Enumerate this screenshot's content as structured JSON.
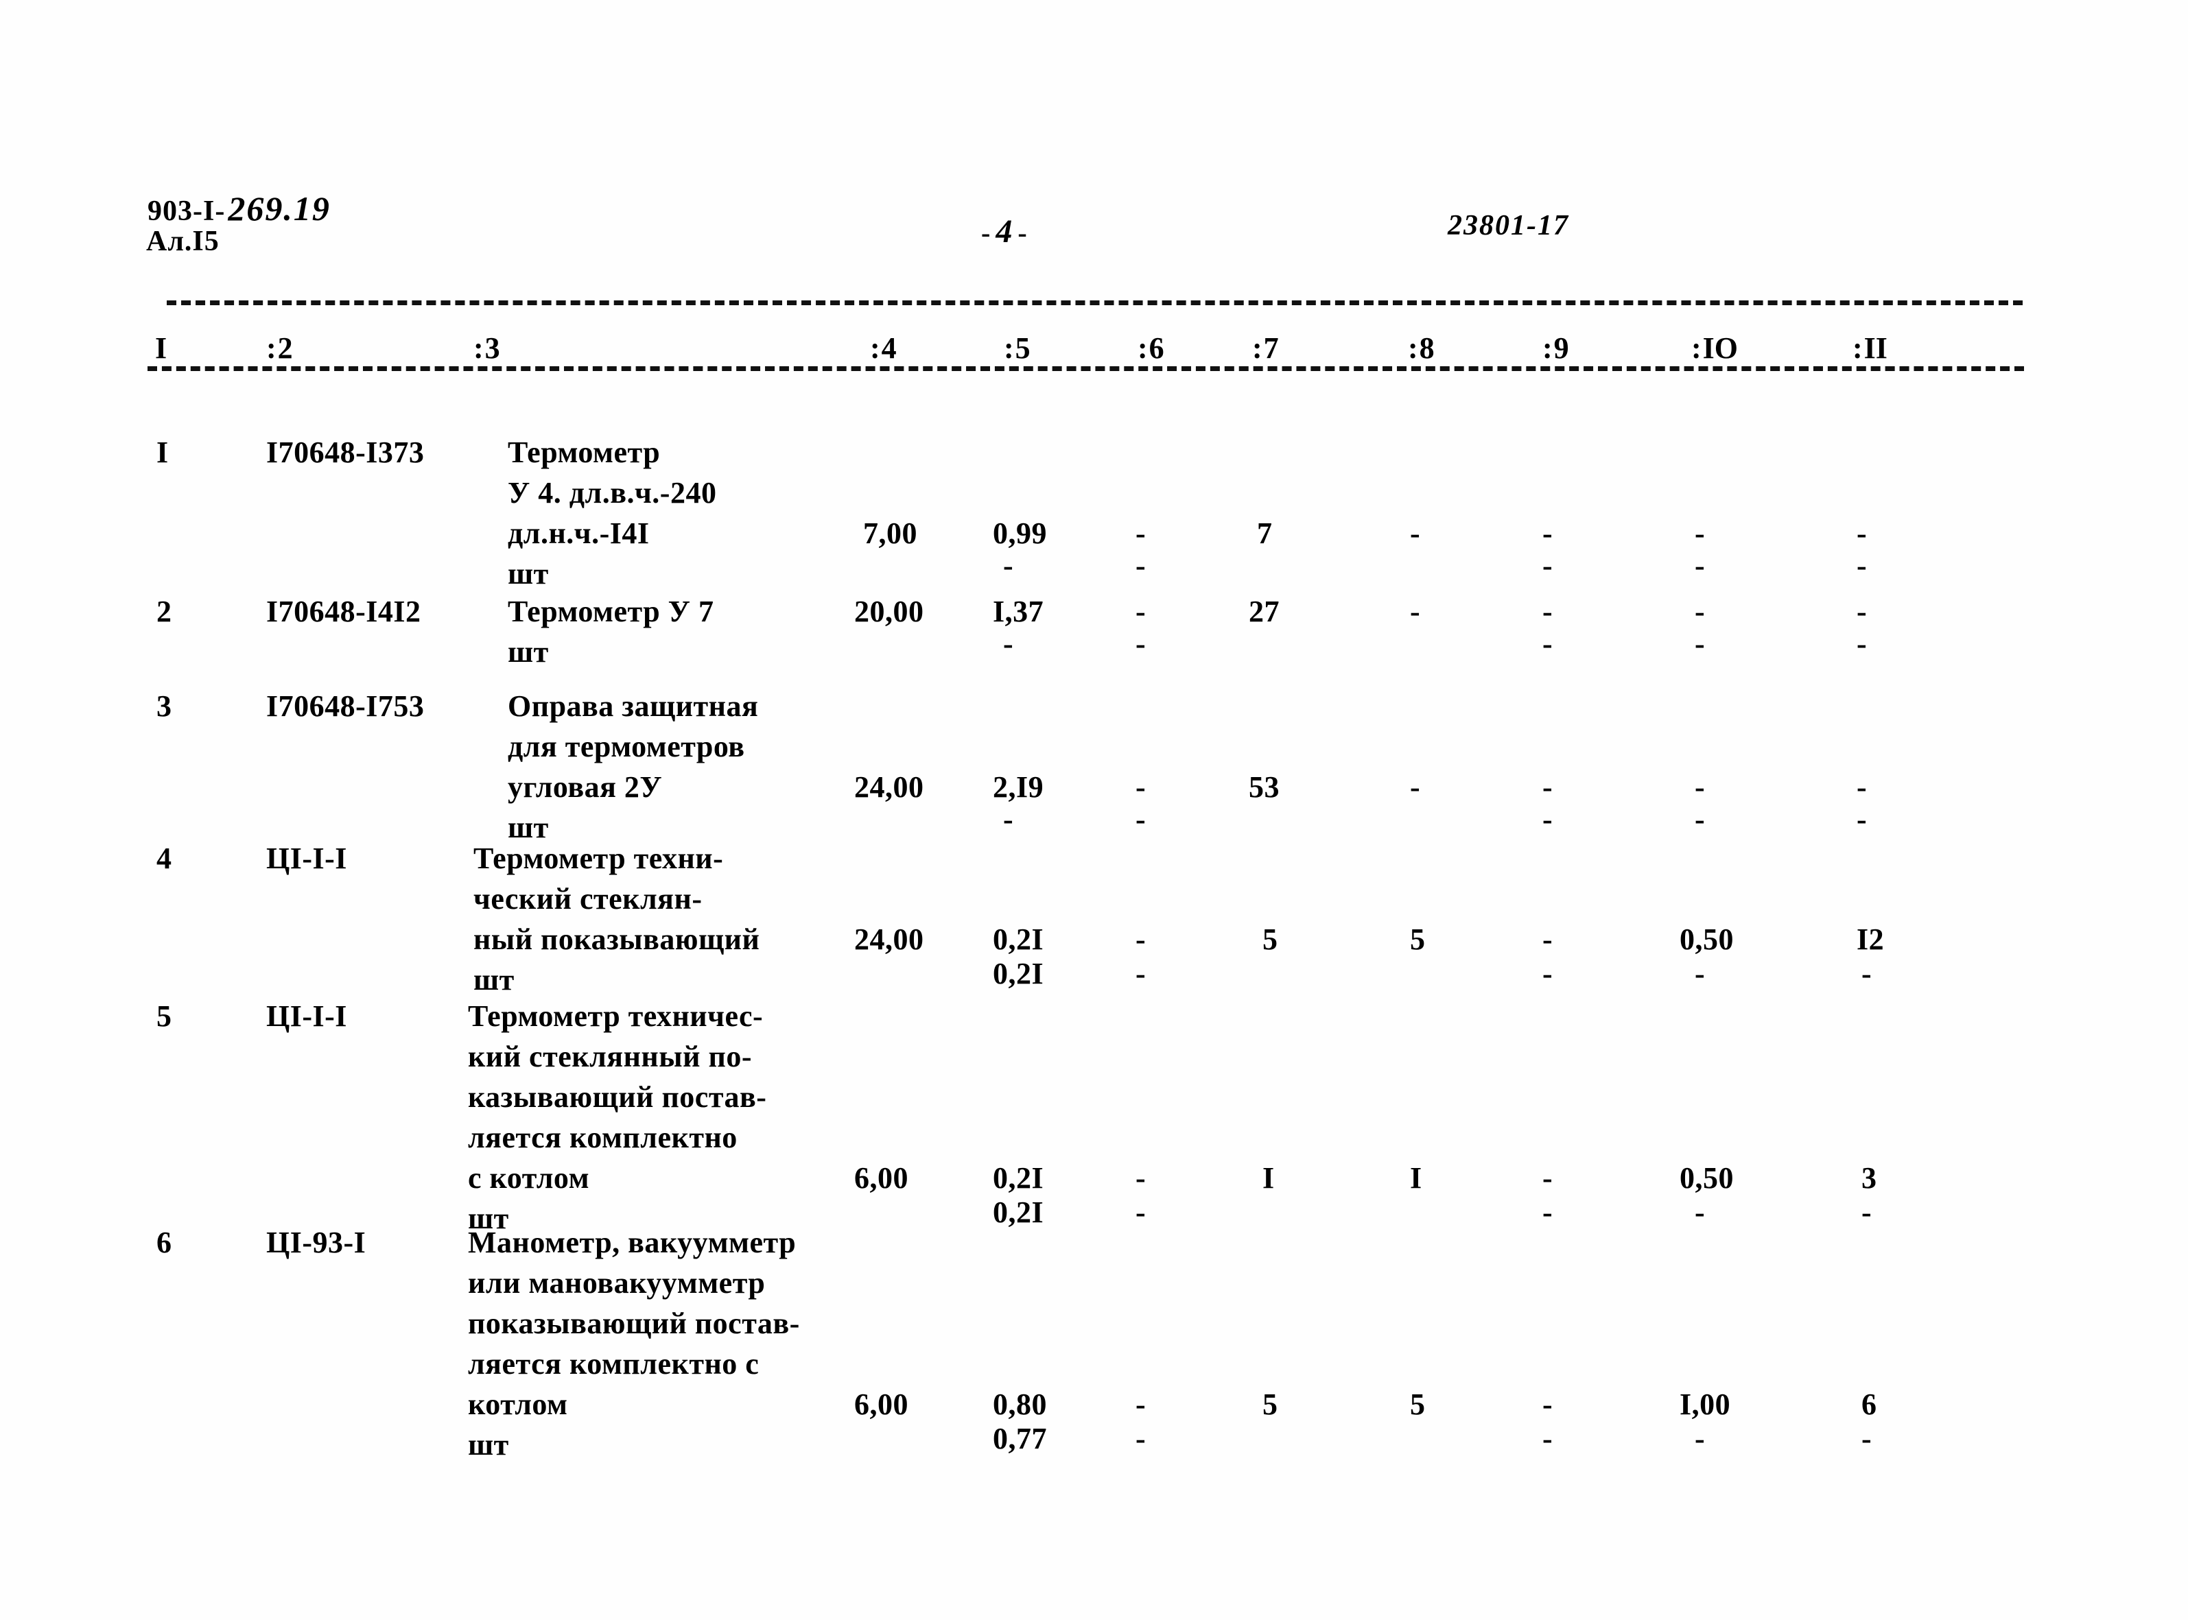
{
  "header": {
    "doc_code_typed": "903-I-",
    "doc_code_hand": "269.19",
    "sheet": "Ал.I5",
    "page_marker_left": "-",
    "page_number": "4",
    "page_marker_right": "-",
    "stamp": "23801-17"
  },
  "table": {
    "column_headers": [
      {
        "colon": ":",
        "label": "I"
      },
      {
        "colon": ":",
        "label": "2"
      },
      {
        "colon": ":",
        "label": "3"
      },
      {
        "colon": ":",
        "label": "4"
      },
      {
        "colon": ":",
        "label": "5"
      },
      {
        "colon": ":",
        "label": "6"
      },
      {
        "colon": ":",
        "label": "7"
      },
      {
        "colon": ":",
        "label": "8"
      },
      {
        "colon": ":",
        "label": "9"
      },
      {
        "colon": ":",
        "label": "IO"
      },
      {
        "colon": ":",
        "label": "II"
      }
    ],
    "rows": [
      {
        "num": "I",
        "code": "I70648-I373",
        "desc_lines": [
          "Термометр",
          "У 4. дл.в.ч.-240",
          "дл.н.ч.-I4I",
          "шт"
        ],
        "unit": "шт",
        "c4": "7,00",
        "c5_top": "0,99",
        "c5_bot": "-",
        "c6_top": "-",
        "c6_bot": "-",
        "c7": "7",
        "c8_top": "-",
        "c8_bot": "",
        "c9_top": "-",
        "c9_bot": "-",
        "c10_top": "-",
        "c10_bot": "-",
        "c11_top": "-",
        "c11_bot": "-"
      },
      {
        "num": "2",
        "code": "I70648-I4I2",
        "desc_lines": [
          "Термометр У 7",
          "шт"
        ],
        "unit": "шт",
        "c4": "20,00",
        "c5_top": "I,37",
        "c5_bot": "-",
        "c6_top": "-",
        "c6_bot": "-",
        "c7": "27",
        "c8_top": "-",
        "c8_bot": "",
        "c9_top": "-",
        "c9_bot": "-",
        "c10_top": "-",
        "c10_bot": "-",
        "c11_top": "-",
        "c11_bot": "-"
      },
      {
        "num": "3",
        "code": "I70648-I753",
        "desc_lines": [
          "Оправа защитная",
          "для термометров",
          "угловая 2У",
          "шт"
        ],
        "unit": "шт",
        "c4": "24,00",
        "c5_top": "2,I9",
        "c5_bot": "-",
        "c6_top": "-",
        "c6_bot": "-",
        "c7": "53",
        "c8_top": "-",
        "c8_bot": "",
        "c9_top": "-",
        "c9_bot": "-",
        "c10_top": "-",
        "c10_bot": "-",
        "c11_top": "-",
        "c11_bot": "-"
      },
      {
        "num": "4",
        "code": "ЦI-I-I",
        "desc_lines": [
          "Термометр техни-",
          "ческий стеклян-",
          "ный показывающий",
          "шт"
        ],
        "unit": "шт",
        "c4": "24,00",
        "c5_top": "0,2I",
        "c5_bot": "0,2I",
        "c6_top": "-",
        "c6_bot": "-",
        "c7": "5",
        "c8_top": "5",
        "c8_bot": "",
        "c9_top": "-",
        "c9_bot": "-",
        "c10_top": "0,50",
        "c10_bot": "-",
        "c11_top": "I2",
        "c11_bot": "-"
      },
      {
        "num": "5",
        "code": "ЦI-I-I",
        "desc_lines": [
          "Термометр техничес-",
          "кий стеклянный по-",
          "казывающий постав-",
          "ляется комплектно",
          "с котлом",
          "шт"
        ],
        "unit": "шт",
        "c4": "6,00",
        "c5_top": "0,2I",
        "c5_bot": "0,2I",
        "c6_top": "-",
        "c6_bot": "-",
        "c7": "I",
        "c8_top": "I",
        "c8_bot": "",
        "c9_top": "-",
        "c9_bot": "-",
        "c10_top": "0,50",
        "c10_bot": "-",
        "c11_top": "3",
        "c11_bot": "-"
      },
      {
        "num": "6",
        "code": "ЦI-93-I",
        "desc_lines": [
          "Манометр, вакуумметр",
          "или мановакуумметр",
          "показывающий постав-",
          "ляется комплектно с",
          "котлом",
          "шт"
        ],
        "unit": "шт",
        "c4": "6,00",
        "c5_top": "0,80",
        "c5_bot": "0,77",
        "c6_top": "-",
        "c6_bot": "-",
        "c7": "5",
        "c8_top": "5",
        "c8_bot": "",
        "c9_top": "-",
        "c9_bot": "-",
        "c10_top": "I,00",
        "c10_bot": "-",
        "c11_top": "6",
        "c11_bot": "-"
      }
    ]
  }
}
